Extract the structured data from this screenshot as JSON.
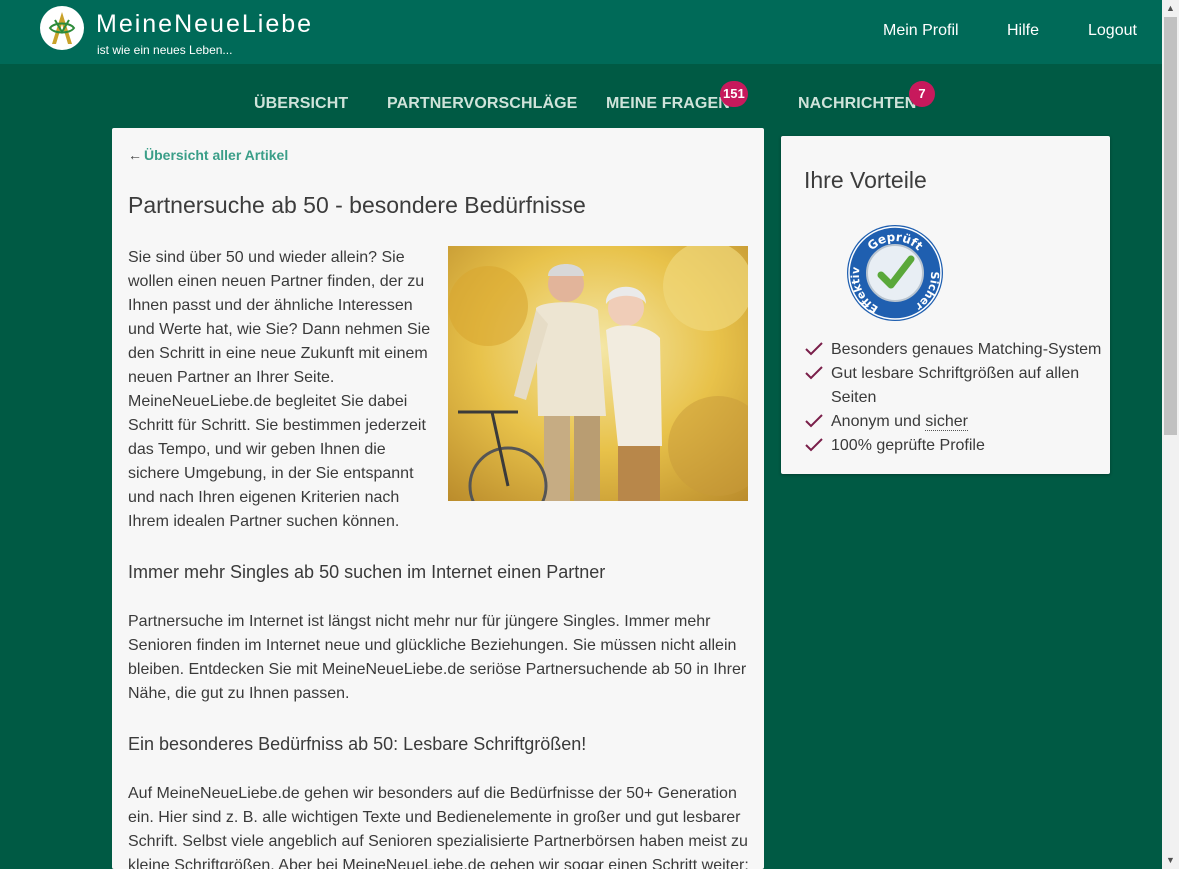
{
  "header": {
    "brand_title": "MeineNeueLiebe",
    "brand_subtitle": "ist wie ein neues Leben...",
    "nav": [
      "Mein Profil",
      "Hilfe",
      "Logout"
    ]
  },
  "main_nav": {
    "items": [
      {
        "label": "ÜBERSICHT"
      },
      {
        "label": "PARTNERVORSCHLÄGE"
      },
      {
        "label": "MEINE FRAGEN",
        "badge": "151"
      },
      {
        "label": "NACHRICHTEN",
        "badge": "7"
      }
    ]
  },
  "article": {
    "back_arrow": "←",
    "back_link": "Übersicht aller Artikel",
    "title": "Partnersuche ab 50 - besondere Bedürfnisse",
    "intro_lines": [
      "Sie sind über 50 und wieder allein? Sie",
      "wollen einen neuen Partner finden, der zu",
      "Ihnen passt und der ähnliche Interessen",
      "und Werte hat, wie Sie? Dann nehmen Sie",
      "den Schritt in eine neue Zukunft mit einem",
      "neuen Partner an Ihrer Seite.",
      "MeineNeueLiebe.de begleitet Sie dabei",
      "Schritt für Schritt. Sie bestimmen jederzeit",
      "das Tempo, und wir geben Ihnen die",
      "sichere Umgebung, in der Sie entspannt",
      "und nach Ihren eigenen Kriterien nach",
      "Ihrem idealen Partner suchen können."
    ],
    "h2_1": "Immer mehr Singles ab 50 suchen im Internet einen Partner",
    "p2_lines": [
      "Partnersuche im Internet ist längst nicht mehr nur für jüngere Singles. Immer mehr",
      "Senioren finden im Internet neue und glückliche Beziehungen. Sie müssen nicht allein",
      "bleiben. Entdecken Sie mit MeineNeueLiebe.de seriöse Partnersuchende ab 50 in Ihrer",
      "Nähe, die gut zu Ihnen passen."
    ],
    "h2_2": "Ein besonderes Bedürfniss ab 50: Lesbare Schriftgrößen!",
    "p3_lines": [
      "Auf MeineNeueLiebe.de gehen wir besonders auf die Bedürfnisse der 50+ Generation",
      "ein. Hier sind z. B. alle wichtigen Texte und Bedienelemente in großer und gut lesbarer",
      "Schrift. Selbst viele angeblich auf Senioren spezialisierte Partnerbörsen haben meist zu",
      "kleine Schriftgrößen. Aber bei MeineNeueLiebe.de gehen wir sogar einen Schritt weiter:"
    ]
  },
  "sidebar": {
    "title": "Ihre Vorteile",
    "seal_top": "Geprüft",
    "seal_left": "Effektiv",
    "seal_right": "Sicher",
    "benefits": [
      "Besonders genaues Matching-System",
      "Gut lesbare Schriftgrößen auf allen Seiten",
      "Anonym und",
      "100% geprüfte Profile"
    ],
    "benefit_link": "sicher"
  },
  "colors": {
    "header": "#006a58",
    "background": "#005a44",
    "badge": "#c7195c",
    "link": "#3a9e88",
    "check": "#7a1f4a"
  }
}
